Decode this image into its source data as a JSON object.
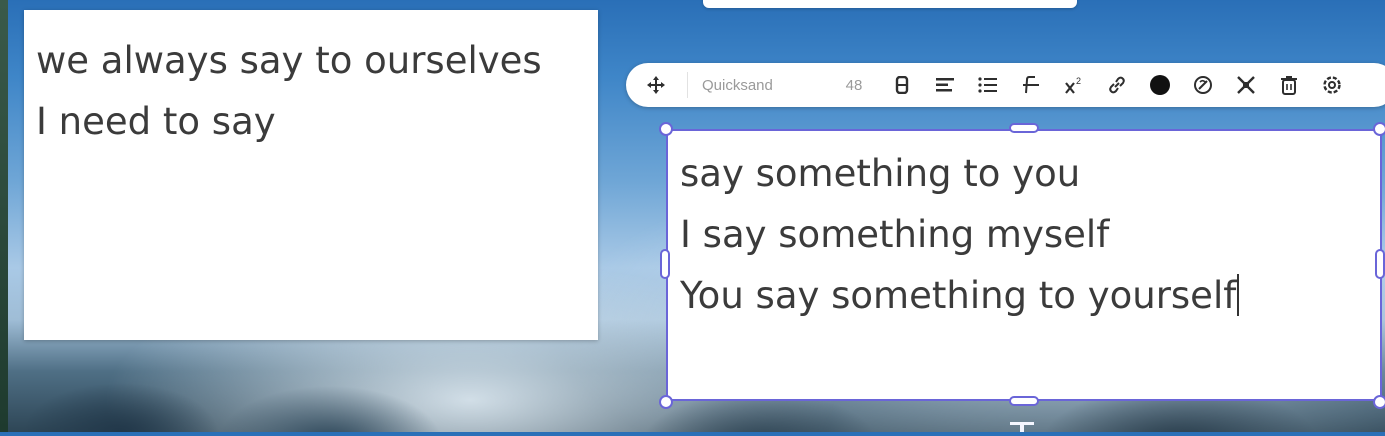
{
  "left_note": {
    "lines": [
      "we always say to ourselves",
      "I need to say"
    ]
  },
  "right_note": {
    "lines": [
      "say something to you",
      "I say something myself",
      "You say something to yourself"
    ]
  },
  "toolbar": {
    "font_name": "Quicksand",
    "font_size": "48",
    "text_color": "#111111",
    "icons": [
      "move-icon",
      "bold-icon",
      "align-icon",
      "list-icon",
      "strikethrough-icon",
      "superscript-icon",
      "link-icon",
      "color-dot-icon",
      "no-fill-icon",
      "fit-icon",
      "delete-icon",
      "settings-icon"
    ]
  },
  "colors": {
    "selection": "#6a65d8",
    "text": "#3b3b3b"
  }
}
